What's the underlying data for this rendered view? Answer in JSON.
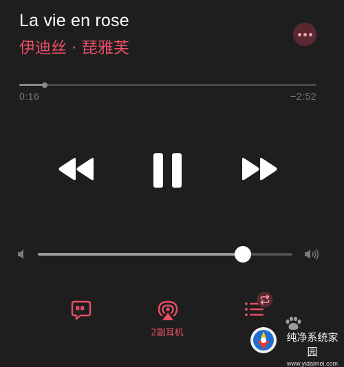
{
  "track": {
    "title": "La vie en rose",
    "artist": "伊迪丝 · 琵雅芙"
  },
  "progress": {
    "elapsed": "0:16",
    "remaining": "−2:52",
    "fraction": 0.085
  },
  "volume": {
    "fraction": 0.805
  },
  "airplay": {
    "label": "2副耳机"
  },
  "icons": {
    "more": "ellipsis-icon",
    "rewind": "rewind-icon",
    "pause": "pause-icon",
    "forward": "fast-forward-icon",
    "volume_low": "speaker-low-icon",
    "volume_high": "speaker-high-icon",
    "lyrics": "lyrics-bubble-icon",
    "airplay": "airplay-icon",
    "queue": "up-next-list-icon",
    "repeat": "repeat-icon"
  },
  "watermark": {
    "text": "纯净系统家园",
    "subtext": "www.yidaimei.com"
  },
  "colors": {
    "background": "#1e1e1e",
    "accent": "#ea4e67",
    "text_primary": "#ffffff",
    "text_secondary": "#7a7a7a",
    "track": "#4a4a4a"
  }
}
